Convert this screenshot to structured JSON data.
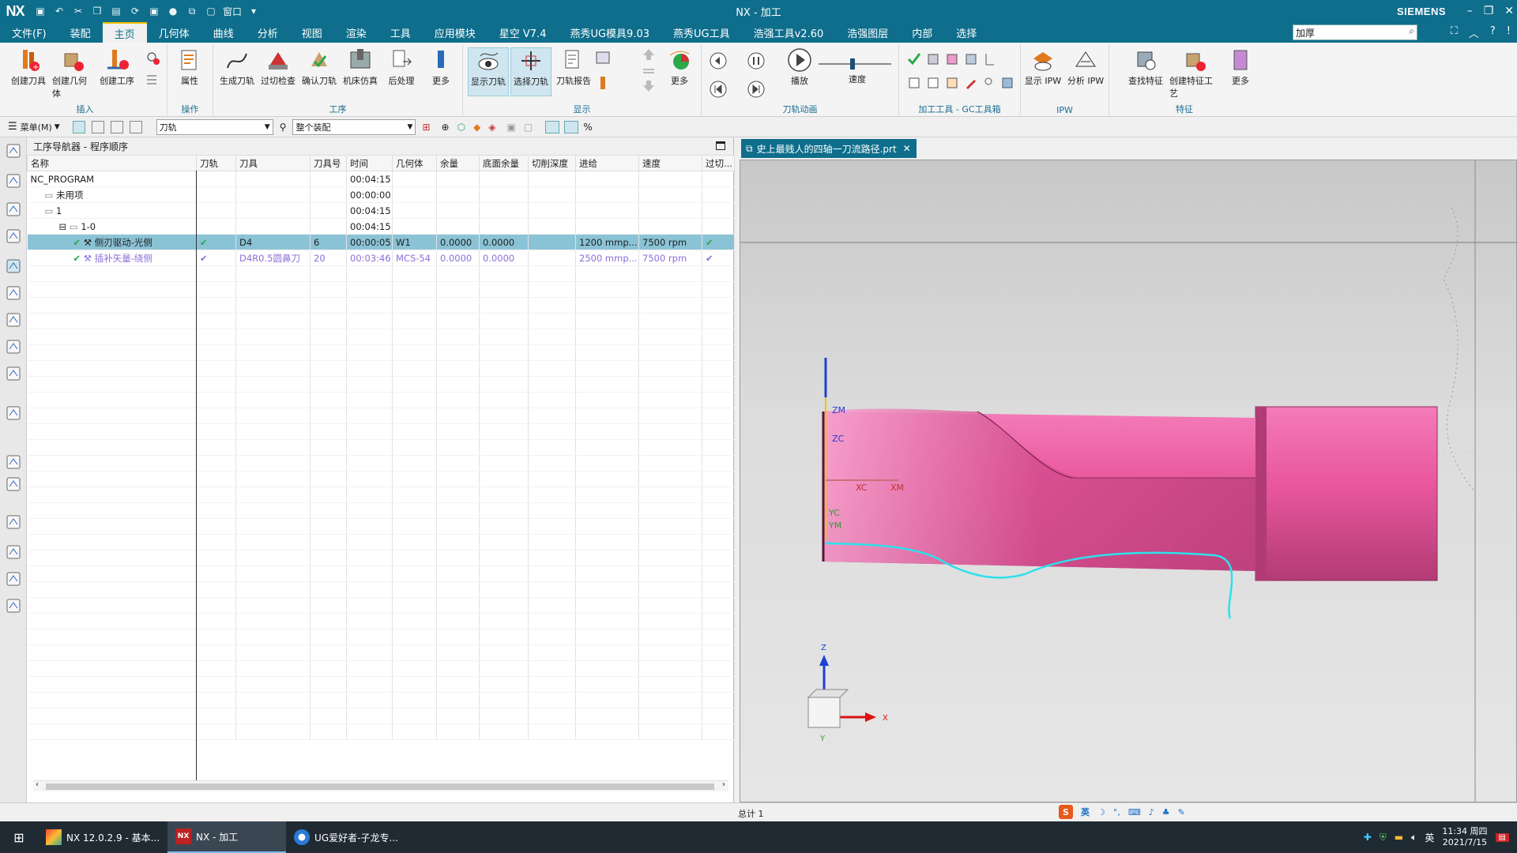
{
  "titlebar": {
    "logo": "NX",
    "title": "NX - 加工",
    "brand": "SIEMENS",
    "window_menu": "窗口"
  },
  "menubar": {
    "items": [
      "文件(F)",
      "装配",
      "主页",
      "几何体",
      "曲线",
      "分析",
      "视图",
      "渲染",
      "工具",
      "应用模块",
      "星空 V7.4",
      "燕秀UG模具9.03",
      "燕秀UG工具",
      "浩强工具v2.60",
      "浩强图层",
      "内部",
      "选择"
    ],
    "active_index": 2,
    "search_value": "加厚"
  },
  "ribbon": {
    "insert": {
      "label": "插入",
      "buttons": [
        "创建刀具",
        "创建几何体",
        "创建工序"
      ]
    },
    "ops": {
      "label": "操作",
      "buttons": [
        "属性"
      ]
    },
    "process": {
      "label": "工序",
      "buttons": [
        "生成刀轨",
        "过切检查",
        "确认刀轨",
        "机床仿真",
        "后处理",
        "更多"
      ]
    },
    "display": {
      "label": "显示",
      "buttons": [
        "显示刀轨",
        "选择刀轨",
        "刀轨报告",
        "更多"
      ]
    },
    "animation": {
      "label": "刀轨动画",
      "play": "播放",
      "speed": "速度"
    },
    "gc": {
      "label": "加工工具 - GC工具箱"
    },
    "ipw": {
      "label": "IPW",
      "buttons": [
        "显示 IPW",
        "分析 IPW"
      ]
    },
    "feature": {
      "label": "特征",
      "buttons": [
        "查找特征",
        "创建特征工艺",
        "更多"
      ]
    }
  },
  "toolbar2": {
    "menu": "菜单(M)",
    "filter": "刀轨",
    "scope": "整个装配"
  },
  "navigator": {
    "title": "工序导航器 - 程序顺序",
    "columns": [
      "名称",
      "刀轨",
      "刀具",
      "刀具号",
      "时间",
      "几何体",
      "余量",
      "底面余量",
      "切削深度",
      "进给",
      "速度",
      "过切..."
    ],
    "rows": [
      {
        "name": "NC_PROGRAM",
        "indent": 0,
        "time": "00:04:15"
      },
      {
        "name": "未用项",
        "indent": 1,
        "time": "00:00:00"
      },
      {
        "name": "1",
        "indent": 1,
        "time": "00:04:15"
      },
      {
        "name": "1-0",
        "indent": 2,
        "time": "00:04:15"
      },
      {
        "name": "侧刃驱动-光侧",
        "indent": 3,
        "path": "✔",
        "tool": "D4",
        "toolno": "6",
        "time": "00:00:05",
        "geom": "W1",
        "stock": "0.0000",
        "floor": "0.0000",
        "depth": "",
        "feed": "1200 mmp...",
        "speed": "7500 rpm",
        "gouge": "✔",
        "selected": true
      },
      {
        "name": "插补矢量-绕侧",
        "indent": 3,
        "path": "✔",
        "tool": "D4R0.5圆鼻刀",
        "toolno": "20",
        "time": "00:03:46",
        "geom": "MCS-54",
        "stock": "0.0000",
        "floor": "0.0000",
        "depth": "",
        "feed": "2500 mmp...",
        "speed": "7500 rpm",
        "gouge": "✔",
        "alt": true
      }
    ]
  },
  "viewport": {
    "tab": "史上最贱人的四轴一刀流路径.prt",
    "labels": {
      "zm": "ZM",
      "zc": "ZC",
      "xc": "XC",
      "xm": "XM",
      "yc": "YC",
      "ym": "YM"
    },
    "triad": {
      "z": "Z",
      "x": "X",
      "y": "Y"
    }
  },
  "status": {
    "total": "总计 1",
    "ime": "英"
  },
  "taskbar": {
    "tasks": [
      "NX 12.0.2.9 - 基本...",
      "NX - 加工",
      "UG爱好者-子龙专..."
    ],
    "time": "11:34 周四",
    "date": "2021/7/15",
    "lang": "英",
    "weekday": "周四"
  },
  "colors": {
    "accent": "#0e6e8c",
    "part": "#e8579b",
    "toolpath": "#2ee0ec"
  }
}
